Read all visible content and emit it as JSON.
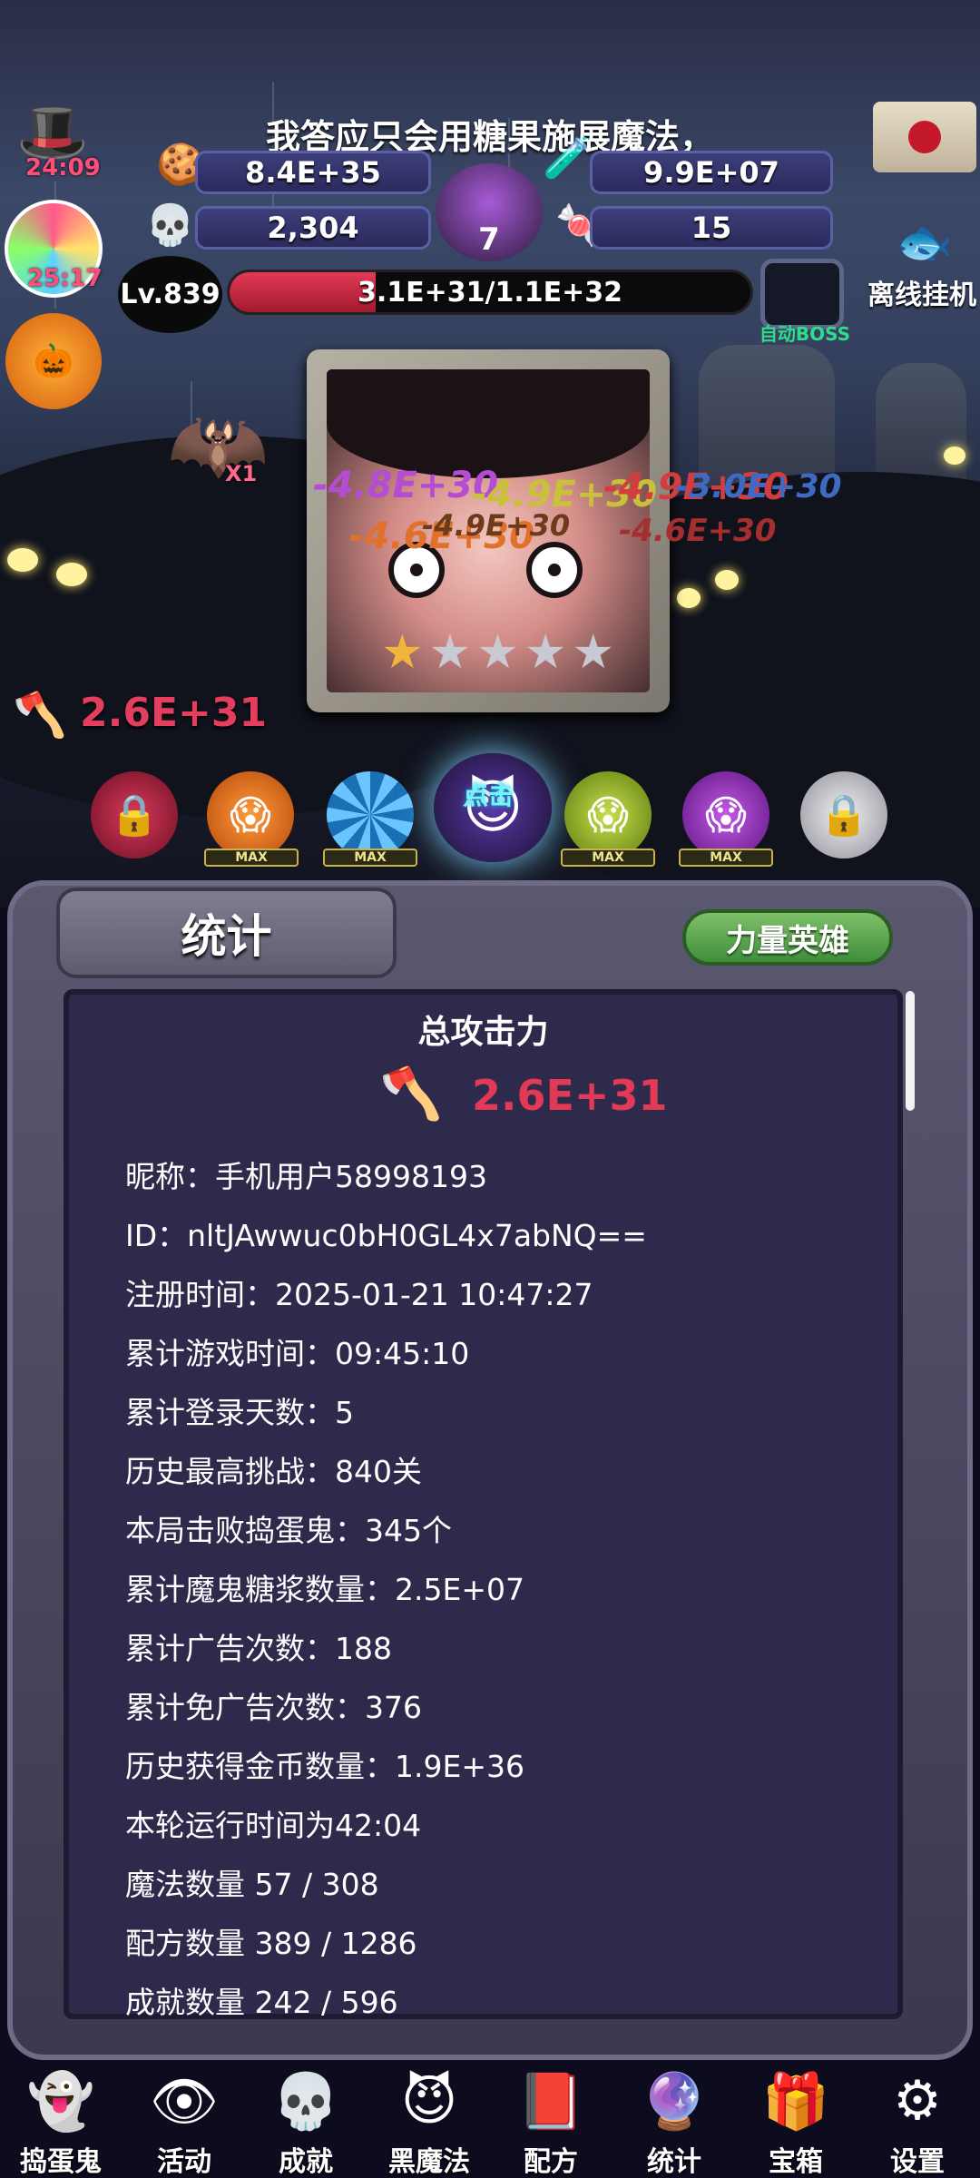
{
  "hud": {
    "quote": "我答应只会用糖果施展魔法，",
    "witch_timer": "24:09",
    "candy_timer": "25:17",
    "candy_count": "8.4E+35",
    "potion_count": "9.9E+07",
    "skull_count": "2,304",
    "cauldron_count": "7",
    "corn_count": "15",
    "level": "Lv.839",
    "hp_text": "3.1E+31/1.1E+32",
    "hp_fraction": 0.28,
    "auto_boss": "自动BOSS",
    "offline": "离线挂机",
    "bat_multiplier": "X1"
  },
  "battle": {
    "attack_power": "2.6E+31",
    "damage_numbers": [
      "-4.8E+30",
      "-4.9E+30",
      "-4.9E+30",
      "-4.6E+30",
      "-4.6E+30",
      "-4.9E+30",
      "-3.0E+30"
    ],
    "tap_label": "点击",
    "stars_filled": 1,
    "stars_total": 5,
    "max_labels": [
      "MAX",
      "MAX",
      "MAX",
      "MAX"
    ]
  },
  "stats": {
    "tab_title": "统计",
    "hero_button": "力量英雄",
    "total_title": "总攻击力",
    "total_value": "2.6E+31",
    "lines": [
      "昵称：手机用户58998193",
      "ID：nltJAwwuc0bH0GL4x7abNQ==",
      "注册时间：2025-01-21 10:47:27",
      "累计游戏时间：09:45:10",
      "累计登录天数：5",
      "历史最高挑战：840关",
      "本局击败捣蛋鬼：345个",
      "累计魔鬼糖浆数量：2.5E+07",
      "累计广告次数：188",
      "累计免广告次数：376",
      "历史获得金币数量：1.9E+36",
      "本轮运行时间为42:04",
      "魔法数量 57 / 308",
      "配方数量 389 / 1286",
      "成就数量 242 / 596"
    ]
  },
  "nav": {
    "items": [
      {
        "label": "捣蛋鬼",
        "icon": "ghost-icon"
      },
      {
        "label": "活动",
        "icon": "eyeball-pot-icon"
      },
      {
        "label": "成就",
        "icon": "skull-trophy-icon"
      },
      {
        "label": "黑魔法",
        "icon": "demon-icon"
      },
      {
        "label": "配方",
        "icon": "spellbook-icon"
      },
      {
        "label": "统计",
        "icon": "crystal-ball-icon"
      },
      {
        "label": "宝箱",
        "icon": "gift-chest-icon"
      },
      {
        "label": "设置",
        "icon": "gear-icon"
      }
    ]
  },
  "colors": {
    "accent_red": "#e23a56",
    "panel_bg": "#2e2a4c",
    "hero_green": "#4f9e45",
    "auto_boss_green": "#2fdc8a"
  }
}
